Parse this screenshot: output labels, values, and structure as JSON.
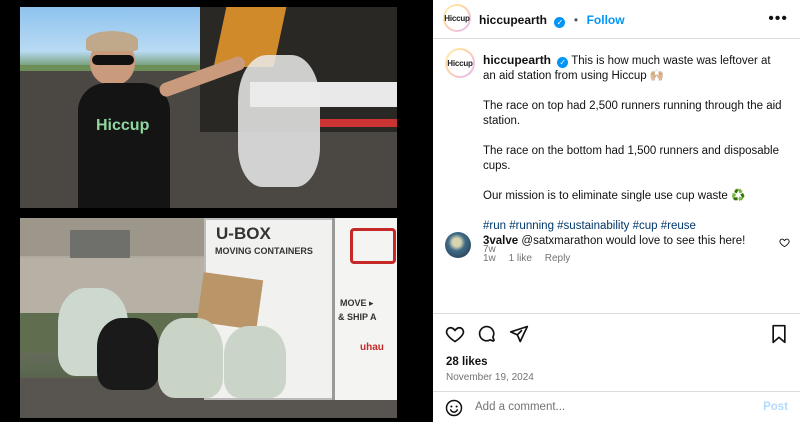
{
  "post": {
    "username": "hiccupearth",
    "avatar_text": "Hiccup",
    "follow_label": "Follow",
    "separator": "•",
    "more_label": "•••"
  },
  "caption": {
    "username": "hiccupearth",
    "line1": "This is how much waste was leftover at an aid station from using Hiccup 🙌🏼",
    "line2": "The race on top had 2,500 runners running through the aid station.",
    "line3": "The race on the bottom had 1,500 runners and disposable cups.",
    "line4": "Our mission is to eliminate single use cup waste ♻️",
    "hashtags": "#run #running #sustainability #cup #reuse",
    "time": "7w"
  },
  "comment": {
    "username": "3valve",
    "text": "@satxmarathon would love to see this here!",
    "time": "1w",
    "likes": "1 like",
    "reply": "Reply"
  },
  "stats": {
    "likes": "28 likes",
    "date": "November 19, 2024"
  },
  "composer": {
    "placeholder": "Add a comment...",
    "post_label": "Post"
  },
  "media": {
    "shirt_text": "Hiccup",
    "truck_text1": "U-BOX",
    "truck_text2": "MOVING CONTAINERS",
    "truck_text3": "MOVE ▸",
    "truck_text4": "& SHIP A",
    "truck_text5": "uhau"
  },
  "colors": {
    "accent": "#0095f6",
    "hashtag": "#00376b",
    "muted": "#737373"
  }
}
